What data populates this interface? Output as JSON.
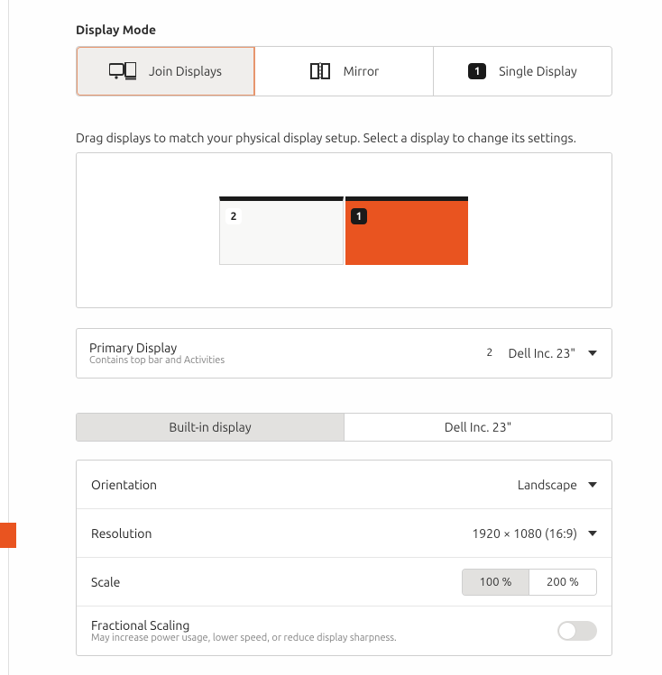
{
  "section_title": "Display Mode",
  "mode_buttons": {
    "join": "Join Displays",
    "mirror": "Mirror",
    "single": "Single Display"
  },
  "hint": "Drag displays to match your physical display setup. Select a display to change its settings.",
  "displays": {
    "d1_badge": "1",
    "d2_badge": "2"
  },
  "primary": {
    "title": "Primary Display",
    "subtitle": "Contains top bar and Activities",
    "value_num": "2",
    "value_name": "Dell Inc. 23\""
  },
  "tabs": {
    "builtin": "Built-in display",
    "external": "Dell Inc. 23\""
  },
  "settings": {
    "orientation": {
      "label": "Orientation",
      "value": "Landscape"
    },
    "resolution": {
      "label": "Resolution",
      "value": "1920 × 1080 (16:9)"
    },
    "scale": {
      "label": "Scale",
      "opt100": "100 %",
      "opt200": "200 %"
    },
    "fractional": {
      "label": "Fractional Scaling",
      "sub": "May increase power usage, lower speed, or reduce display sharpness."
    }
  }
}
